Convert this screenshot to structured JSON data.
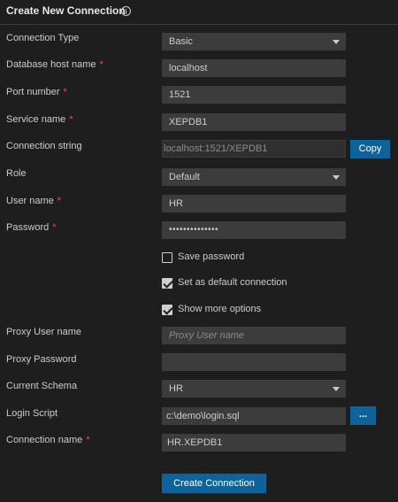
{
  "header": {
    "title": "Create New Connection",
    "info_icon": "info-icon"
  },
  "fields": {
    "connection_type": {
      "label": "Connection Type",
      "value": "Basic"
    },
    "host": {
      "label": "Database host name",
      "required": "*",
      "value": "localhost"
    },
    "port": {
      "label": "Port number",
      "required": "*",
      "value": "1521"
    },
    "service": {
      "label": "Service name",
      "required": "*",
      "value": "XEPDB1"
    },
    "connection_string": {
      "label": "Connection string",
      "value": "localhost:1521/XEPDB1",
      "copy_label": "Copy"
    },
    "role": {
      "label": "Role",
      "value": "Default"
    },
    "user": {
      "label": "User name",
      "required": "*",
      "value": "HR"
    },
    "password": {
      "label": "Password",
      "required": "*",
      "value": "••••••••••••••"
    },
    "proxy_user": {
      "label": "Proxy User name",
      "placeholder": "Proxy User name"
    },
    "proxy_password": {
      "label": "Proxy Password",
      "value": ""
    },
    "schema": {
      "label": "Current Schema",
      "value": "HR"
    },
    "login_script": {
      "label": "Login Script",
      "value": "c:\\demo\\login.sql",
      "browse_label": "..."
    },
    "connection_name": {
      "label": "Connection name",
      "required": "*",
      "value": "HR.XEPDB1"
    }
  },
  "checkboxes": {
    "save_password": {
      "label": "Save password",
      "checked": false
    },
    "default_connection": {
      "label": "Set as default connection",
      "checked": true
    },
    "more_options": {
      "label": "Show more options",
      "checked": true
    }
  },
  "actions": {
    "create_label": "Create Connection"
  },
  "colors": {
    "background": "#1e1e1e",
    "field": "#3c3c3c",
    "accent": "#0e639c",
    "required": "#f14c4c"
  }
}
